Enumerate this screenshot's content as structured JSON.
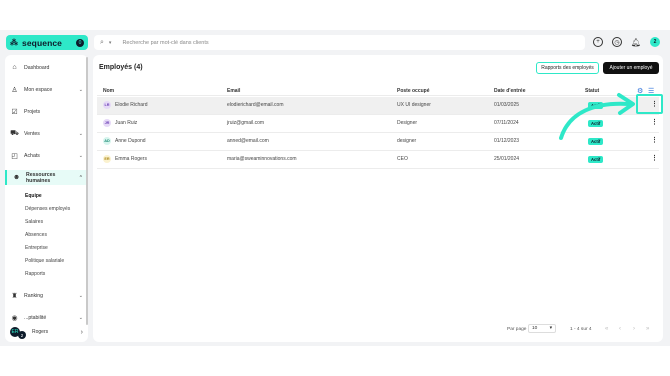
{
  "header": {
    "logo_text": "sequence",
    "logo_badge": "0",
    "search_placeholder": "Recherche par mot-clé dans clients",
    "avatar_initial": "2"
  },
  "sidebar": {
    "items": [
      {
        "label": "Dashboard",
        "icon": "home-icon"
      },
      {
        "label": "Mon espace",
        "icon": "person-icon",
        "chevron": "⌄"
      },
      {
        "label": "Projets",
        "icon": "check-square-icon"
      },
      {
        "label": "Ventes",
        "icon": "cart-icon",
        "chevron": "⌄"
      },
      {
        "label": "Achats",
        "icon": "bag-icon",
        "chevron": "⌄"
      },
      {
        "label": "Ressources humaines",
        "icon": "people-icon",
        "chevron": "⌃"
      },
      {
        "label": "Ranking",
        "icon": "ranking-icon",
        "chevron": "⌄"
      },
      {
        "label": "...ptabilité",
        "icon": "accounting-icon",
        "chevron": "⌄"
      }
    ],
    "subitems": [
      "Equipe",
      "Dépenses employés",
      "Salaires",
      "Absences",
      "Entreprise",
      "Politique salariale",
      "Rapports"
    ],
    "user": {
      "initials": "ER",
      "badge": "2",
      "name": "Rogers",
      "chevron": "›"
    }
  },
  "main": {
    "title": "Employés (4)",
    "btn_reports": "Rapports des employés",
    "btn_add": "Ajouter un employé",
    "columns": [
      "Nom",
      "Email",
      "Poste occupé",
      "Date d'entrée",
      "Statut"
    ],
    "rows": [
      {
        "initials": "LR",
        "name": "Elodie Richard",
        "email": "elodierichard@email.com",
        "role": "UX UI designer",
        "date": "01/03/2025",
        "status": "Actif",
        "av_color": "#e6d9f7",
        "av_text": "#6a3fb5"
      },
      {
        "initials": "JR",
        "name": "Juan Ruiz",
        "email": "jruiz@gmail.com",
        "role": "Designer",
        "date": "07/11/2024",
        "status": "Actif",
        "av_color": "#e6d9f7",
        "av_text": "#6a3fb5"
      },
      {
        "initials": "AD",
        "name": "Anne Dupond",
        "email": "anned@email.com",
        "role": "designer",
        "date": "01/12/2023",
        "status": "Actif",
        "av_color": "#d7f5ee",
        "av_text": "#1b8a74"
      },
      {
        "initials": "ER",
        "name": "Emma Rogers",
        "email": "maria@sweaminnovations.com",
        "role": "CEO",
        "date": "25/01/2024",
        "status": "Actif",
        "av_color": "#fbf2cf",
        "av_text": "#a88412"
      }
    ],
    "pagination": {
      "per_page_label": "Par page",
      "per_page_value": "10",
      "range": "1 - 4 sur 4"
    }
  },
  "colors": {
    "accent": "#2ee8c8",
    "dark": "#0d1b2a"
  }
}
